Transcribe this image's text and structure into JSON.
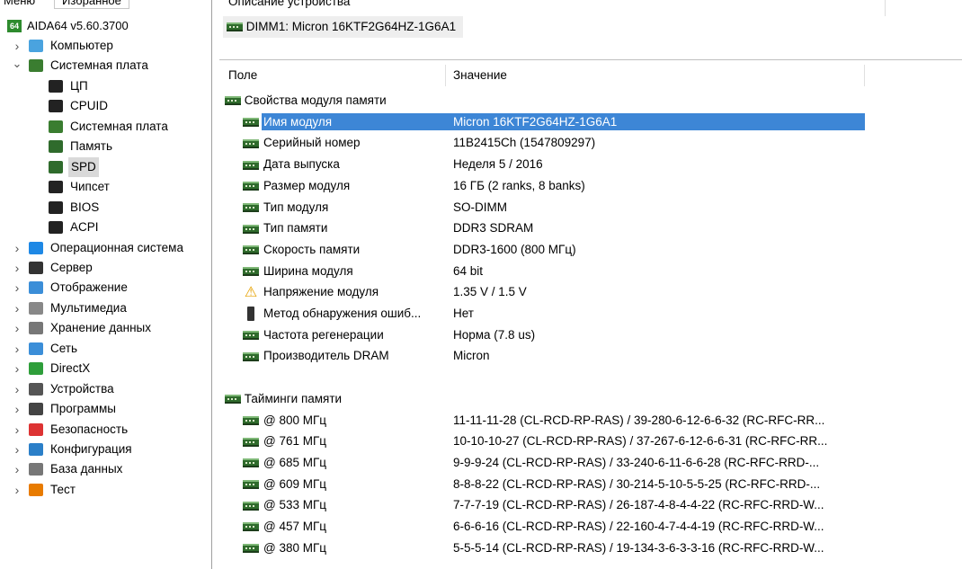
{
  "left_tabs": [
    {
      "label": "Меню"
    },
    {
      "label": "Избранное"
    }
  ],
  "tree": {
    "root": "AIDA64 v5.60.3700",
    "root_badge": "64",
    "items": [
      {
        "label": "Компьютер",
        "level": 1,
        "expand": "›",
        "icon": "computer-icon",
        "color": "#4aa3df"
      },
      {
        "label": "Системная плата",
        "level": 1,
        "expand": "⌄",
        "icon": "motherboard-icon",
        "color": "#3a7d30"
      },
      {
        "label": "ЦП",
        "level": 2,
        "icon": "cpu-icon",
        "color": "#222"
      },
      {
        "label": "CPUID",
        "level": 2,
        "icon": "cpuid-icon",
        "color": "#222"
      },
      {
        "label": "Системная плата",
        "level": 2,
        "icon": "motherboard-icon",
        "color": "#3a7d30"
      },
      {
        "label": "Память",
        "level": 2,
        "icon": "memory-icon",
        "color": "#2f6b2c"
      },
      {
        "label": "SPD",
        "level": 2,
        "icon": "memory-icon",
        "color": "#2f6b2c",
        "selected": true
      },
      {
        "label": "Чипсет",
        "level": 2,
        "icon": "chipset-icon",
        "color": "#222"
      },
      {
        "label": "BIOS",
        "level": 2,
        "icon": "bios-icon",
        "color": "#222"
      },
      {
        "label": "ACPI",
        "level": 2,
        "icon": "acpi-icon",
        "color": "#222"
      },
      {
        "label": "Операционная система",
        "level": 1,
        "expand": "›",
        "icon": "windows-icon",
        "color": "#1e88e5"
      },
      {
        "label": "Сервер",
        "level": 1,
        "expand": "›",
        "icon": "server-icon",
        "color": "#333"
      },
      {
        "label": "Отображение",
        "level": 1,
        "expand": "›",
        "icon": "display-icon",
        "color": "#3b8ed8"
      },
      {
        "label": "Мультимедиа",
        "level": 1,
        "expand": "›",
        "icon": "speaker-icon",
        "color": "#888"
      },
      {
        "label": "Хранение данных",
        "level": 1,
        "expand": "›",
        "icon": "storage-icon",
        "color": "#777"
      },
      {
        "label": "Сеть",
        "level": 1,
        "expand": "›",
        "icon": "network-icon",
        "color": "#3b8ed8"
      },
      {
        "label": "DirectX",
        "level": 1,
        "expand": "›",
        "icon": "directx-icon",
        "color": "#2e9e3a"
      },
      {
        "label": "Устройства",
        "level": 1,
        "expand": "›",
        "icon": "devices-icon",
        "color": "#555"
      },
      {
        "label": "Программы",
        "level": 1,
        "expand": "›",
        "icon": "programs-icon",
        "color": "#444"
      },
      {
        "label": "Безопасность",
        "level": 1,
        "expand": "›",
        "icon": "security-icon",
        "color": "#d33"
      },
      {
        "label": "Конфигурация",
        "level": 1,
        "expand": "›",
        "icon": "config-icon",
        "color": "#2b7fc8"
      },
      {
        "label": "База данных",
        "level": 1,
        "expand": "›",
        "icon": "database-icon",
        "color": "#777"
      },
      {
        "label": "Тест",
        "level": 1,
        "expand": "›",
        "icon": "test-icon",
        "color": "#e87b00"
      }
    ]
  },
  "device": {
    "section_label": "Описание устройства",
    "name": "DIMM1: Micron 16KTF2G64HZ-1G6A1"
  },
  "columns": {
    "field": "Поле",
    "value": "Значение"
  },
  "groups": [
    {
      "title": "Свойства модуля памяти",
      "rows": [
        {
          "field": "Имя модуля",
          "value": "Micron 16KTF2G64HZ-1G6A1",
          "icon": "ram",
          "selected": true
        },
        {
          "field": "Серийный номер",
          "value": "11B2415Ch (1547809297)",
          "icon": "ram"
        },
        {
          "field": "Дата выпуска",
          "value": "Неделя 5 / 2016",
          "icon": "ram"
        },
        {
          "field": "Размер модуля",
          "value": "16 ГБ (2 ranks, 8 banks)",
          "icon": "ram"
        },
        {
          "field": "Тип модуля",
          "value": "SO-DIMM",
          "icon": "ram"
        },
        {
          "field": "Тип памяти",
          "value": "DDR3 SDRAM",
          "icon": "ram"
        },
        {
          "field": "Скорость памяти",
          "value": "DDR3-1600 (800 МГц)",
          "icon": "ram"
        },
        {
          "field": "Ширина модуля",
          "value": "64 bit",
          "icon": "ram"
        },
        {
          "field": "Напряжение модуля",
          "value": "1.35 V / 1.5 V",
          "icon": "warning"
        },
        {
          "field": "Метод обнаружения ошиб...",
          "value": "Нет",
          "icon": "phone"
        },
        {
          "field": "Частота регенерации",
          "value": "Норма (7.8 us)",
          "icon": "ram"
        },
        {
          "field": "Производитель DRAM",
          "value": "Micron",
          "icon": "ram"
        }
      ]
    },
    {
      "title": "Тайминги памяти",
      "rows": [
        {
          "field": "@ 800 МГц",
          "value": "11-11-11-28  (CL-RCD-RP-RAS) / 39-280-6-12-6-6-32  (RC-RFC-RR...",
          "icon": "ram"
        },
        {
          "field": "@ 761 МГц",
          "value": "10-10-10-27  (CL-RCD-RP-RAS) / 37-267-6-12-6-6-31  (RC-RFC-RR...",
          "icon": "ram"
        },
        {
          "field": "@ 685 МГц",
          "value": "9-9-9-24  (CL-RCD-RP-RAS) / 33-240-6-11-6-6-28  (RC-RFC-RRD-...",
          "icon": "ram"
        },
        {
          "field": "@ 609 МГц",
          "value": "8-8-8-22  (CL-RCD-RP-RAS) / 30-214-5-10-5-5-25  (RC-RFC-RRD-...",
          "icon": "ram"
        },
        {
          "field": "@ 533 МГц",
          "value": "7-7-7-19  (CL-RCD-RP-RAS) / 26-187-4-8-4-4-22  (RC-RFC-RRD-W...",
          "icon": "ram"
        },
        {
          "field": "@ 457 МГц",
          "value": "6-6-6-16  (CL-RCD-RP-RAS) / 22-160-4-7-4-4-19  (RC-RFC-RRD-W...",
          "icon": "ram"
        },
        {
          "field": "@ 380 МГц",
          "value": "5-5-5-14  (CL-RCD-RP-RAS) / 19-134-3-6-3-3-16  (RC-RFC-RRD-W...",
          "icon": "ram"
        }
      ]
    }
  ]
}
